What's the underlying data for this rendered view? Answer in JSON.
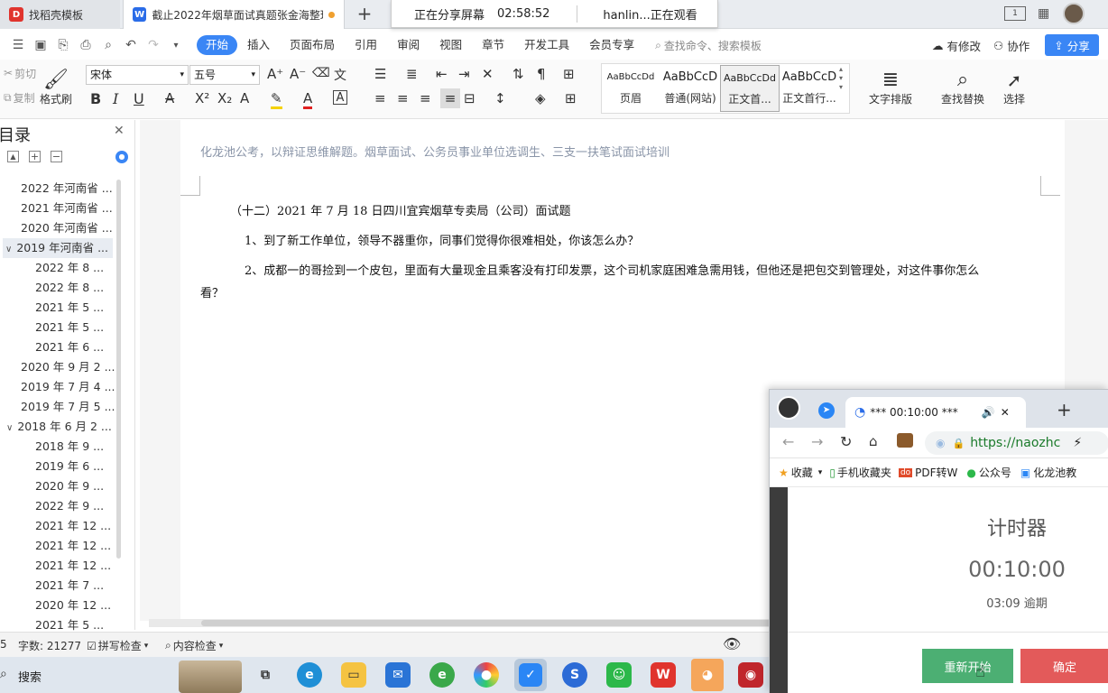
{
  "tabs": [
    {
      "label": "找稻壳模板"
    },
    {
      "label": "截止2022年烟草面试真题张金海整理"
    }
  ],
  "share_banner": {
    "status": "正在分享屏幕",
    "timer": "02:58:52",
    "watching": "hanlin...正在观看"
  },
  "menu": {
    "items": [
      "开始",
      "插入",
      "页面布局",
      "引用",
      "审阅",
      "视图",
      "章节",
      "开发工具",
      "会员专享"
    ],
    "search": "查找命令、搜索模板",
    "modified": "有修改",
    "collab": "协作",
    "share": "分享"
  },
  "ribbon": {
    "cut": "剪切",
    "copy": "复制",
    "format_painter": "格式刷",
    "font_name": "宋体",
    "font_size": "五号",
    "styles": [
      {
        "sample": "AaBbCcDd",
        "name": "页眉"
      },
      {
        "sample": "AaBbCcD",
        "name": "普通(网站)"
      },
      {
        "sample": "AaBbCcDd",
        "name": "正文首..."
      },
      {
        "sample": "AaBbCcD",
        "name": "正文首行..."
      }
    ],
    "text_layout": "文字排版",
    "find_replace": "查找替换",
    "select": "选择"
  },
  "sidebar": {
    "title": "目录",
    "items": [
      {
        "label": "2022 年河南省 ...",
        "level": 1
      },
      {
        "label": "2021 年河南省 ...",
        "level": 1
      },
      {
        "label": "2020 年河南省 ...",
        "level": 1
      },
      {
        "label": "2019 年河南省 ...",
        "level": 1,
        "expanded": true
      },
      {
        "label": "2022 年 8 ...",
        "level": 2
      },
      {
        "label": "2022 年 8 ...",
        "level": 2
      },
      {
        "label": "2021 年 5 ...",
        "level": 2
      },
      {
        "label": "2021 年 5 ...",
        "level": 2
      },
      {
        "label": "2021 年 6 ...",
        "level": 2
      },
      {
        "label": "2020 年 9 月 2 ...",
        "level": 1
      },
      {
        "label": "2019 年 7 月 4 ...",
        "level": 1
      },
      {
        "label": "2019 年 7 月 5 ...",
        "level": 1
      },
      {
        "label": "2018 年 6 月 2 ...",
        "level": 1,
        "expanded": true
      },
      {
        "label": "2018 年 9 ...",
        "level": 2
      },
      {
        "label": "2019 年 6 ...",
        "level": 2
      },
      {
        "label": "2020 年 9 ...",
        "level": 2
      },
      {
        "label": "2022 年 9 ...",
        "level": 2
      },
      {
        "label": "2021 年 12 ...",
        "level": 2
      },
      {
        "label": "2021 年 12 ...",
        "level": 2
      },
      {
        "label": "2021 年 12 ...",
        "level": 2
      },
      {
        "label": "2021 年 7 ...",
        "level": 2
      },
      {
        "label": "2020 年 12 ...",
        "level": 2
      },
      {
        "label": "2021 年 5 ...",
        "level": 2
      }
    ]
  },
  "document": {
    "header": "化龙池公考，以辩证思维解题。烟草面试、公务员事业单位选调生、三支一扶笔试面试培训",
    "heading": "（十二）2021 年 7 月 18 日四川宜宾烟草专卖局（公司）面试题",
    "q1": "1、到了新工作单位，领导不器重你，同事们觉得你很难相处，你该怎么办？",
    "q2_line1": "2、成都一的哥捡到一个皮包，里面有大量现金且乘客没有打印发票，这个司机家庭困难急需用钱，但他还是把包交到管理处，对这件事你怎么",
    "q2_line2": "看？"
  },
  "status": {
    "page": "5",
    "word_count": "字数: 21277",
    "spell_check": "拼写检查",
    "content_check": "内容检查"
  },
  "taskbar": {
    "search": "搜索"
  },
  "popup": {
    "tab_title": "*** 00:10:00 ***",
    "url": "https://naozhc",
    "bookmarks": [
      "收藏",
      "手机收藏夹",
      "PDF转W",
      "公众号",
      "化龙池教"
    ],
    "timer_title": "计时器",
    "timer_value": "00:10:00",
    "overdue": "03:09 逾期",
    "restart": "重新开始",
    "confirm": "确定"
  }
}
